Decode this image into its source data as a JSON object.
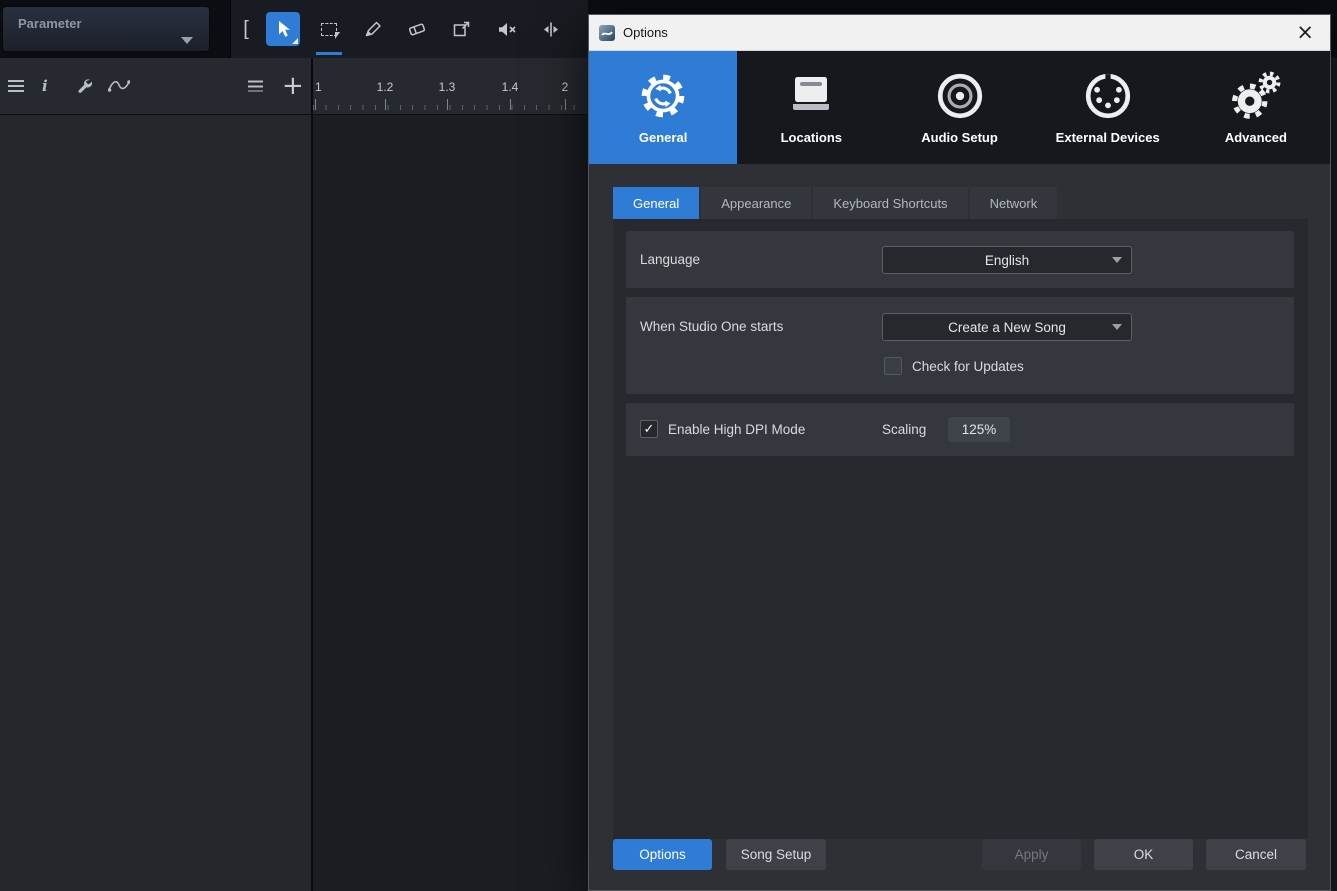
{
  "colors": {
    "accent": "#2e7cd6",
    "titlebar": "#f1f1f1",
    "dialog_bg": "#2e3036",
    "panel_bg": "#34373d"
  },
  "icons": {
    "close": "×",
    "check": "✓",
    "info": "i",
    "plus": "+",
    "bracket": "["
  },
  "daw": {
    "parameter_label": "Parameter",
    "ruler_labels": [
      "1",
      "1.2",
      "1.3",
      "1.4",
      "2"
    ],
    "tools": [
      "bracket",
      "arrow",
      "range-select",
      "pencil",
      "eraser",
      "slip",
      "mute",
      "bend"
    ]
  },
  "dialog": {
    "title": "Options",
    "nav": [
      {
        "label": "General",
        "selected": true
      },
      {
        "label": "Locations",
        "selected": false
      },
      {
        "label": "Audio Setup",
        "selected": false
      },
      {
        "label": "External Devices",
        "selected": false
      },
      {
        "label": "Advanced",
        "selected": false
      }
    ],
    "tabs": [
      {
        "label": "General",
        "selected": true
      },
      {
        "label": "Appearance",
        "selected": false
      },
      {
        "label": "Keyboard Shortcuts",
        "selected": false
      },
      {
        "label": "Network",
        "selected": false
      }
    ],
    "general": {
      "language_label": "Language",
      "language_value": "English",
      "startup_label": "When Studio One starts",
      "startup_value": "Create a New Song",
      "check_updates_label": "Check for Updates",
      "check_updates_checked": false,
      "dpi_label": "Enable High DPI Mode",
      "dpi_checked": true,
      "scaling_label": "Scaling",
      "scaling_value": "125%"
    },
    "footer": {
      "options": "Options",
      "song_setup": "Song Setup",
      "apply": "Apply",
      "ok": "OK",
      "cancel": "Cancel"
    }
  }
}
